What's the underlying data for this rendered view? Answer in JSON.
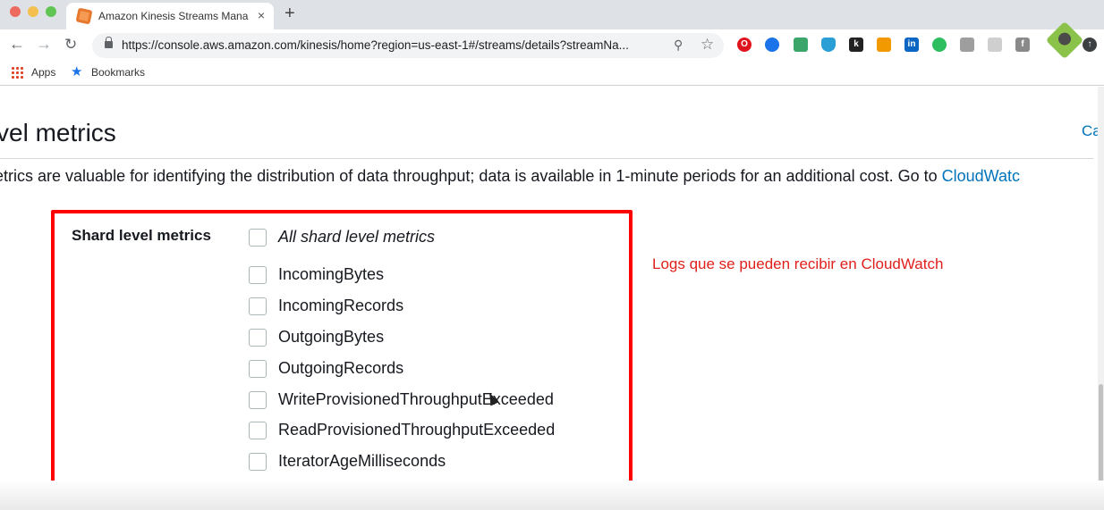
{
  "browser": {
    "tab_title": "Amazon Kinesis Streams Mana",
    "tab_close": "×",
    "new_tab": "+",
    "url": "https://console.aws.amazon.com/kinesis/home?region=us-east-1#/streams/details?streamNa...",
    "bookmarks": {
      "apps": "Apps",
      "bookmarks": "Bookmarks"
    }
  },
  "extensions": [
    "opera-icon",
    "pin-icon",
    "mail-icon",
    "shield-icon",
    "k-icon",
    "warning-icon",
    "linkedin-icon",
    "evernote-icon",
    "drive-icon",
    "tree-icon",
    "facebook-icon"
  ],
  "page": {
    "section_title": "vel metrics",
    "cancel_link": "Ca",
    "description": "etrics are valuable for identifying the distribution of data throughput; data is available in 1-minute periods for an additional cost. Go to ",
    "description_link": "CloudWatc",
    "shard_metrics": {
      "label": "Shard level metrics",
      "all_option": "All shard level metrics",
      "options": [
        "IncomingBytes",
        "IncomingRecords",
        "OutgoingBytes",
        "OutgoingRecords",
        "WriteProvisionedThroughputExceeded",
        "ReadProvisionedThroughputExceeded",
        "IteratorAgeMilliseconds"
      ]
    },
    "annotation": "Logs que se pueden recibir en CloudWatch"
  },
  "colors": {
    "highlight_border": "#ff0000",
    "annotation": "#e0201c",
    "link": "#0073bb"
  }
}
